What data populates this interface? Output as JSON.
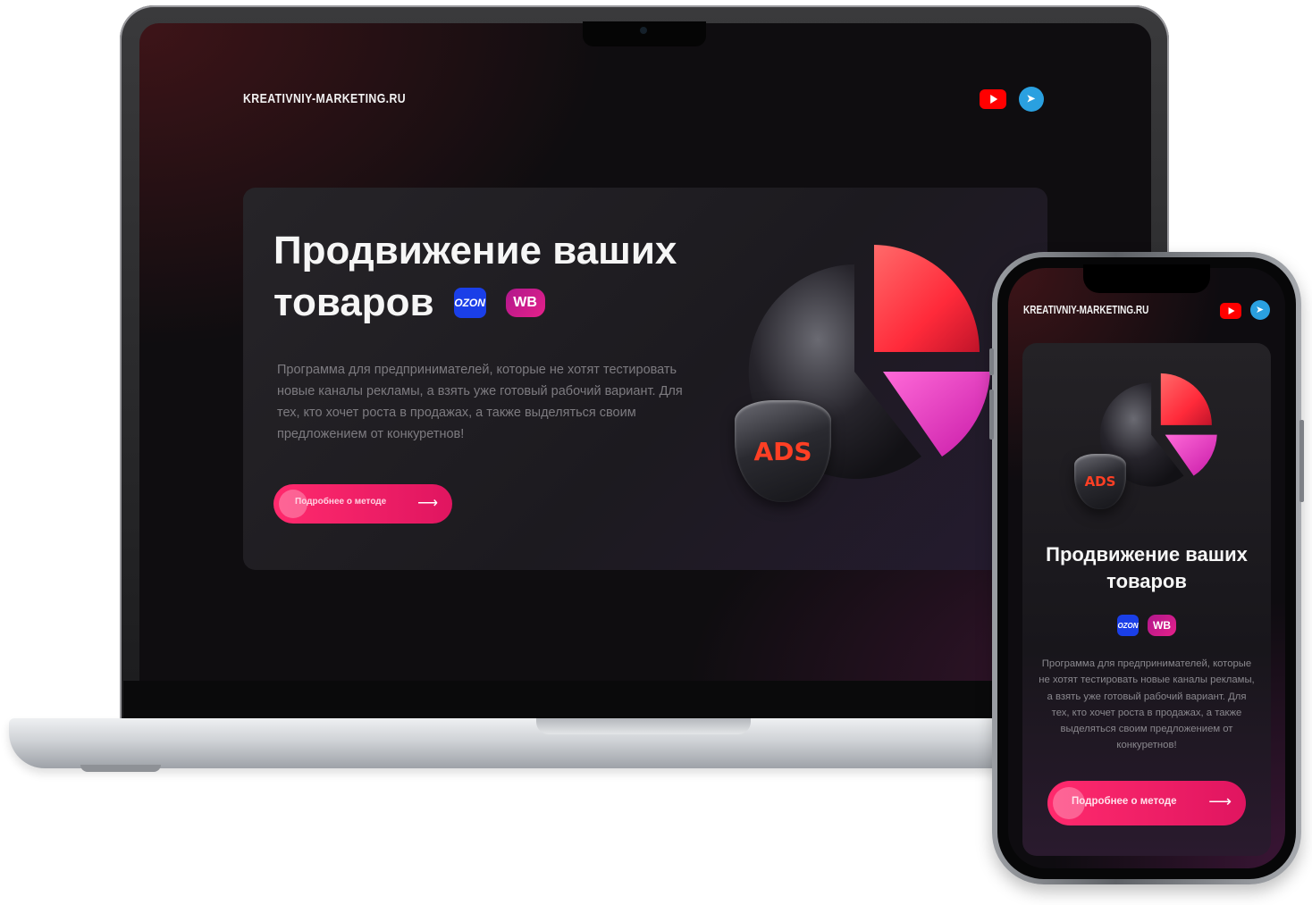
{
  "site": {
    "logo": "KREATIVNIY-MARKETING.RU",
    "social": [
      "youtube-icon",
      "telegram-icon"
    ]
  },
  "hero": {
    "title_line1": "Продвижение ваших",
    "title_line2": "товаров",
    "title_mobile": "Продвижение ваших товаров",
    "badges": {
      "ozon": "OZON",
      "wb": "WB"
    },
    "description": "Программа для предпринимателей, которые не хотят тестировать новые каналы рекламы, а взять уже готовый рабочий вариант. Для тех, кто хочет роста в продажах, а также выделяться своим предложением от конкуретнов!",
    "cta_label": "Подробнее о методе",
    "cta_arrow": "⟶",
    "illustration_label": "ADS"
  },
  "colors": {
    "accent": "#ff2a6d",
    "ozon": "#1a3fe8",
    "wb": "#cb1b8b",
    "youtube": "#ff0000",
    "telegram": "#2aa0e0",
    "ads_text": "#ff3f24"
  }
}
